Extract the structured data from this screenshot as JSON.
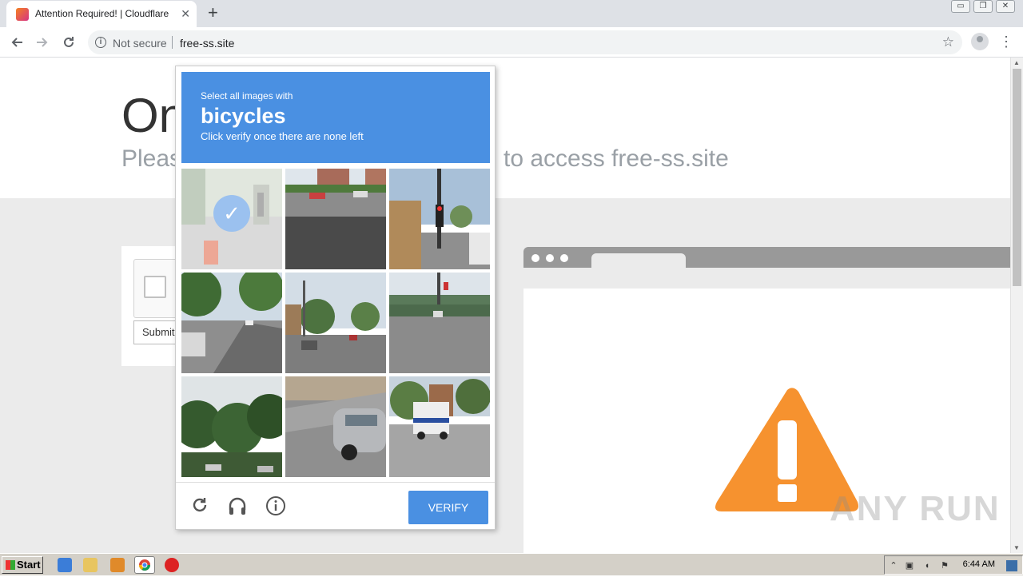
{
  "browser": {
    "tab_title": "Attention Required! | Cloudflare",
    "tab_close": "✕",
    "new_tab": "+",
    "security_label": "Not secure",
    "url": "free-ss.site",
    "window_controls": [
      "▭",
      "❐",
      "✕"
    ]
  },
  "page": {
    "heading": "On",
    "subheading_left": "Pleas",
    "subheading_right": "to access free-ss.site",
    "submit_label": "Submit"
  },
  "captcha": {
    "prompt_small": "Select all images with",
    "target": "bicycles",
    "instruction": "Click verify once there are none left",
    "verify_label": "VERIFY",
    "header_color": "#4a90e2",
    "tiles": [
      {
        "scene": "street-cyclists",
        "selected": true
      },
      {
        "scene": "highway-road",
        "selected": false
      },
      {
        "scene": "traffic-light-street",
        "selected": false
      },
      {
        "scene": "tree-lined-road",
        "selected": false
      },
      {
        "scene": "suburban-street",
        "selected": false
      },
      {
        "scene": "highway-overpass",
        "selected": false
      },
      {
        "scene": "trees-parking",
        "selected": false
      },
      {
        "scene": "parked-van",
        "selected": false
      },
      {
        "scene": "delivery-truck",
        "selected": false
      }
    ]
  },
  "watermark": "ANY RUN",
  "taskbar": {
    "start_label": "Start",
    "clock": "6:44 AM"
  },
  "colors": {
    "warning": "#f6922f",
    "illustration_gray": "#999999"
  }
}
